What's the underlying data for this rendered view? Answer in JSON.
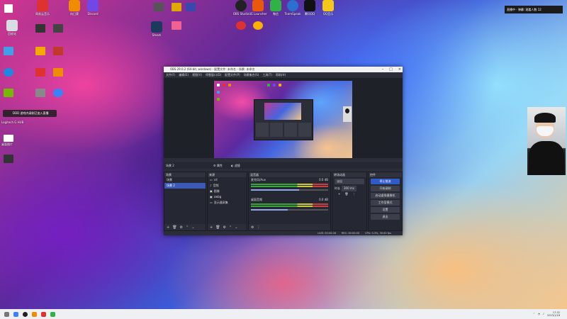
{
  "desktop": {
    "icons": [
      {
        "label": "回收站",
        "color": "#d8dde3"
      },
      {
        "label": "网易云音乐",
        "color": "#e03131"
      },
      {
        "label": "向日葵",
        "color": "#f08c00"
      },
      {
        "label": "Discord",
        "color": "#7048e8"
      },
      {
        "label": "Steam",
        "color": "#1c3a5e"
      },
      {
        "label": "OBS Studio",
        "color": "#222"
      },
      {
        "label": "UE Launcher",
        "color": "#444"
      },
      {
        "label": "微信",
        "color": "#2fb344"
      },
      {
        "label": "TeamSpeak",
        "color": "#2b6fd0"
      },
      {
        "label": "腾讯QQ",
        "color": "#111"
      },
      {
        "label": "QQ音乐",
        "color": "#f5c71a"
      }
    ],
    "pinned_notice": "DDD 游戏内录制已加入直播",
    "corner_labels": [
      "Logitech G HUB",
      "桌面图片"
    ]
  },
  "notification": {
    "text": "直播中 · 弹幕: 观看人数 12"
  },
  "obs": {
    "title": "OBS 29.0.2 (64-bit, windows) - 配置文件: 未命名 - 场景: 未命名",
    "menu": [
      "文件(F)",
      "编辑(E)",
      "视图(V)",
      "停靠窗口(D)",
      "配置文件(P)",
      "场景集合(S)",
      "工具(T)",
      "帮助(H)"
    ],
    "scene_label": "场景 2",
    "scene_buttons": [
      "属性",
      "滤镜"
    ],
    "docks": {
      "scenes": {
        "title": "场景",
        "items": [
          "场景",
          "场景 2"
        ],
        "selected": 1
      },
      "sources": {
        "title": "来源",
        "items": [
          "cd",
          "音频",
          "图像",
          "zwbg",
          "显示器采集"
        ]
      },
      "mixer": {
        "title": "混音器",
        "channels": [
          {
            "name": "麦克风/Aux",
            "db": "0.0 dB",
            "level": 0.62
          },
          {
            "name": "桌面音频",
            "db": "0.0 dB",
            "level": 0.48
          }
        ]
      },
      "transitions": {
        "title": "转场动画",
        "type": "淡出",
        "duration_label": "时长",
        "duration": "300 ms"
      },
      "controls": {
        "title": "控件",
        "buttons": [
          "停止推流",
          "开始录制",
          "启动虚拟摄像机",
          "工作室模式",
          "设置",
          "退出"
        ]
      }
    },
    "status": {
      "live": "LIVE: 00:00:26",
      "rec": "REC: 00:00:00",
      "cpu": "CPU: 0.3%, 30.00 fps"
    }
  },
  "taskbar": {
    "time": "17:32",
    "date": "2023/1/18"
  }
}
